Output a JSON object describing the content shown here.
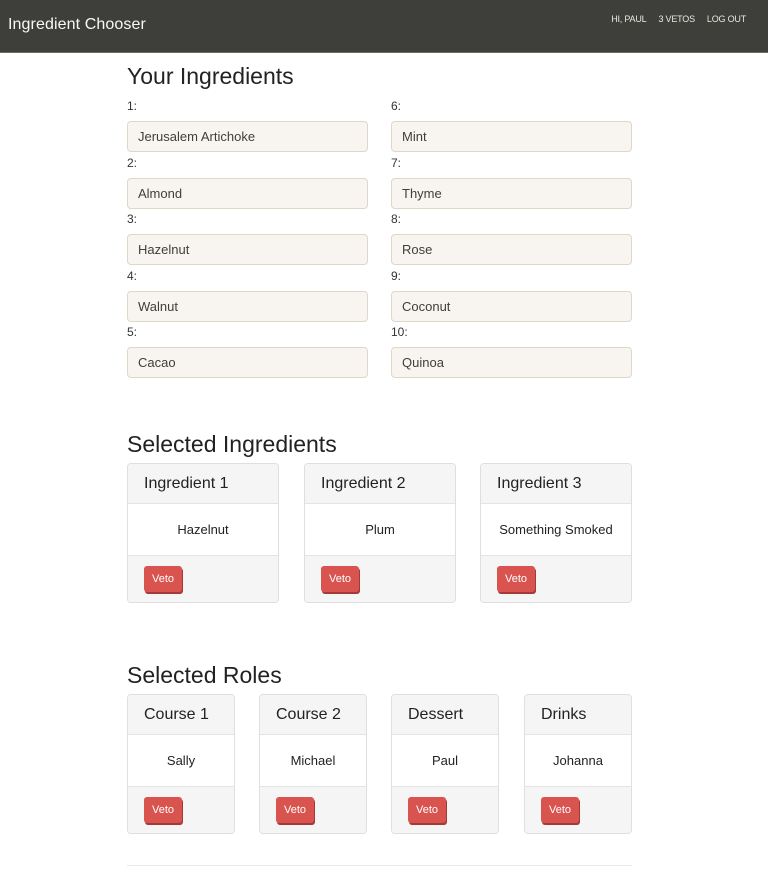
{
  "navbar": {
    "brand": "Ingredient Chooser",
    "links": [
      "Hi, Paul",
      "3 Vetos",
      "Log Out"
    ]
  },
  "your_ingredients": {
    "title": "Your Ingredients",
    "items": [
      {
        "label": "1:",
        "value": "Jerusalem Artichoke"
      },
      {
        "label": "2:",
        "value": "Almond"
      },
      {
        "label": "3:",
        "value": "Hazelnut"
      },
      {
        "label": "4:",
        "value": "Walnut"
      },
      {
        "label": "5:",
        "value": "Cacao"
      },
      {
        "label": "6:",
        "value": "Mint"
      },
      {
        "label": "7:",
        "value": "Thyme"
      },
      {
        "label": "8:",
        "value": "Rose"
      },
      {
        "label": "9:",
        "value": "Coconut"
      },
      {
        "label": "10:",
        "value": "Quinoa"
      }
    ]
  },
  "selected_ingredients": {
    "title": "Selected Ingredients",
    "cards": [
      {
        "header": "Ingredient 1",
        "value": "Hazelnut",
        "button": "Veto"
      },
      {
        "header": "Ingredient 2",
        "value": "Plum",
        "button": "Veto"
      },
      {
        "header": "Ingredient 3",
        "value": "Something Smoked",
        "button": "Veto"
      }
    ]
  },
  "selected_roles": {
    "title": "Selected Roles",
    "cards": [
      {
        "header": "Course 1",
        "value": "Sally",
        "button": "Veto"
      },
      {
        "header": "Course 2",
        "value": "Michael",
        "button": "Veto"
      },
      {
        "header": "Dessert",
        "value": "Paul",
        "button": "Veto"
      },
      {
        "header": "Drinks",
        "value": "Johanna",
        "button": "Veto"
      }
    ]
  },
  "colors": {
    "navbar": "#3e3f3a",
    "input_bg": "#f8f5f0",
    "danger": "#d9534f"
  }
}
